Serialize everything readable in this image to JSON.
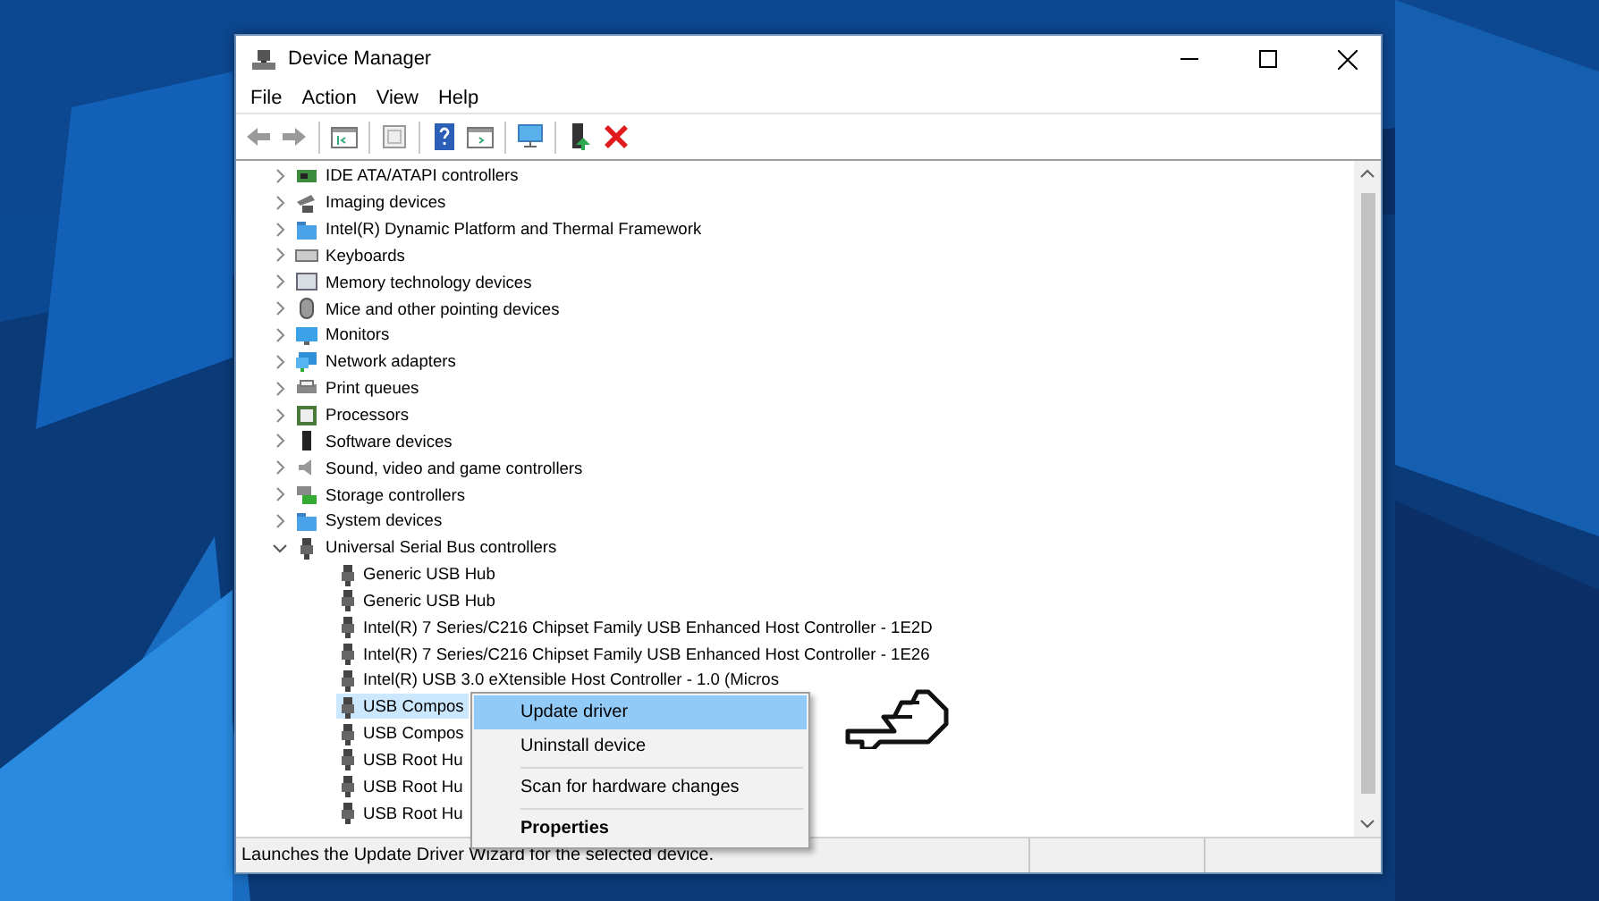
{
  "window": {
    "title": "Device Manager"
  },
  "menu": [
    "File",
    "Action",
    "View",
    "Help"
  ],
  "toolbar": [
    {
      "kind": "back"
    },
    {
      "kind": "forward"
    },
    {
      "kind": "sep"
    },
    {
      "kind": "tree"
    },
    {
      "kind": "sep"
    },
    {
      "kind": "props"
    },
    {
      "kind": "sep"
    },
    {
      "kind": "help"
    },
    {
      "kind": "pane"
    },
    {
      "kind": "sep"
    },
    {
      "kind": "scan"
    },
    {
      "kind": "sep"
    },
    {
      "kind": "update"
    },
    {
      "kind": "remove"
    }
  ],
  "tree": [
    {
      "label": "IDE ATA/ATAPI controllers",
      "kind": "ide",
      "expanded": false
    },
    {
      "label": "Imaging devices",
      "kind": "camera",
      "expanded": false
    },
    {
      "label": "Intel(R) Dynamic Platform and Thermal Framework",
      "kind": "folder",
      "expanded": false
    },
    {
      "label": "Keyboards",
      "kind": "keyboard",
      "expanded": false
    },
    {
      "label": "Memory technology devices",
      "kind": "memory",
      "expanded": false
    },
    {
      "label": "Mice and other pointing devices",
      "kind": "mouse",
      "expanded": false
    },
    {
      "label": "Monitors",
      "kind": "monitor",
      "expanded": false
    },
    {
      "label": "Network adapters",
      "kind": "network",
      "expanded": false
    },
    {
      "label": "Print queues",
      "kind": "printer",
      "expanded": false
    },
    {
      "label": "Processors",
      "kind": "cpu",
      "expanded": false
    },
    {
      "label": "Software devices",
      "kind": "software",
      "expanded": false
    },
    {
      "label": "Sound, video and game controllers",
      "kind": "speaker",
      "expanded": false
    },
    {
      "label": "Storage controllers",
      "kind": "storage",
      "expanded": false
    },
    {
      "label": "System devices",
      "kind": "folder",
      "expanded": false
    },
    {
      "label": "Universal Serial Bus controllers",
      "kind": "usb",
      "expanded": true,
      "children": [
        {
          "label": "Generic USB Hub",
          "selected": false
        },
        {
          "label": "Generic USB Hub",
          "selected": false
        },
        {
          "label": "Intel(R) 7 Series/C216 Chipset Family USB Enhanced Host Controller - 1E2D",
          "selected": false
        },
        {
          "label": "Intel(R) 7 Series/C216 Chipset Family USB Enhanced Host Controller - 1E26",
          "selected": false
        },
        {
          "label": "Intel(R) USB 3.0 eXtensible Host Controller - 1.0 (Micros",
          "selected": false
        },
        {
          "label": "USB Compos",
          "selected": true
        },
        {
          "label": "USB Compos",
          "selected": false
        },
        {
          "label": "USB Root Hu",
          "selected": false
        },
        {
          "label": "USB Root Hu",
          "selected": false
        },
        {
          "label": "USB Root Hu",
          "selected": false
        }
      ]
    }
  ],
  "context_menu": [
    {
      "kind": "item",
      "label": "Update driver",
      "selected": true,
      "default": false
    },
    {
      "kind": "item",
      "label": "Uninstall device",
      "selected": false,
      "default": false
    },
    {
      "kind": "separator"
    },
    {
      "kind": "item",
      "label": "Scan for hardware changes",
      "selected": false,
      "default": false
    },
    {
      "kind": "separator"
    },
    {
      "kind": "item",
      "label": "Properties",
      "selected": false,
      "default": true
    }
  ],
  "status_bar": "Launches the Update Driver Wizard for the selected device."
}
